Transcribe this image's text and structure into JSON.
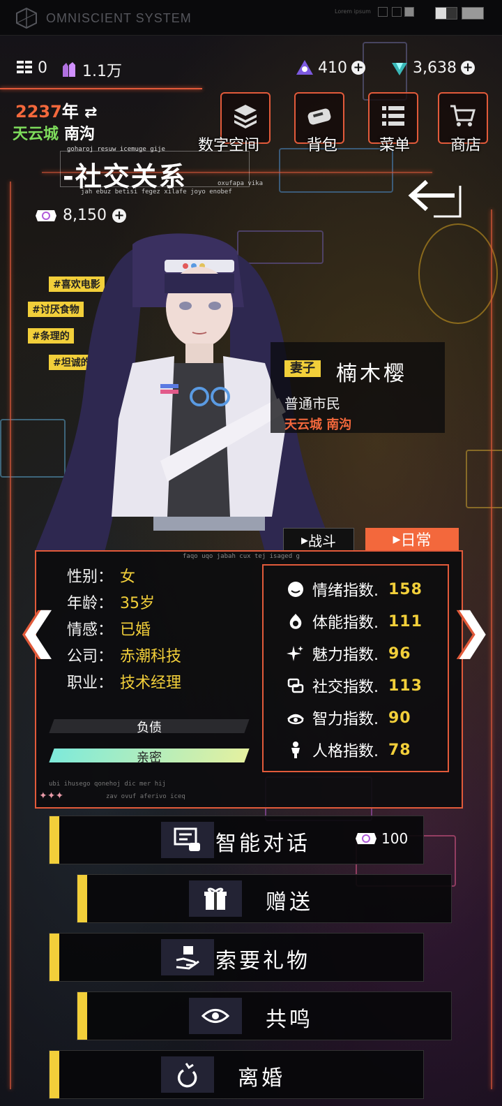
{
  "header": {
    "system_title": "OMNISCIENT SYSTEM",
    "lorem": "Lorem ipsum"
  },
  "resources": {
    "puzzle": "0",
    "crystal": "1.1万",
    "ticket": "410",
    "diamond": "3,638"
  },
  "date": {
    "year": "2237",
    "year_label": "年"
  },
  "location": {
    "city": "天云城",
    "district": "南沟"
  },
  "nav": [
    {
      "label": "数字空间",
      "icon": "data-stack-icon"
    },
    {
      "label": "背包",
      "icon": "bag-icon"
    },
    {
      "label": "菜单",
      "icon": "menu-list-icon"
    },
    {
      "label": "商店",
      "icon": "cart-icon"
    }
  ],
  "page": {
    "title": "-社交关系",
    "tiny1": "goharoj resuw icemuge gije",
    "tiny2": "oxufapa vika",
    "tiny3": "jah ebuz betisi fegez xilafe joyo enobef"
  },
  "coin": {
    "value": "8,150"
  },
  "tags": [
    "#喜欢电影",
    "#讨厌食物",
    "#条理的",
    "#坦诚的"
  ],
  "character": {
    "relation": "妻子",
    "name": "楠木樱",
    "role": "普通市民",
    "location": "天云城 南沟"
  },
  "tabs": {
    "battle": "战斗",
    "daily": "日常"
  },
  "panel_tiny": "faqo uqo jabah cux tej isaged g",
  "info": [
    {
      "label": "性别：",
      "value": "女"
    },
    {
      "label": "年龄：",
      "value": "35岁"
    },
    {
      "label": "情感：",
      "value": "已婚"
    },
    {
      "label": "公司：",
      "value": "赤潮科技"
    },
    {
      "label": "职业：",
      "value": "技术经理"
    }
  ],
  "stats": [
    {
      "label": "情绪指数.",
      "value": "158",
      "icon": "mood-icon"
    },
    {
      "label": "体能指数.",
      "value": "111",
      "icon": "stamina-icon"
    },
    {
      "label": "魅力指数.",
      "value": "96",
      "icon": "sparkle-icon"
    },
    {
      "label": "社交指数.",
      "value": "113",
      "icon": "social-icon"
    },
    {
      "label": "智力指数.",
      "value": "90",
      "icon": "intellect-icon"
    },
    {
      "label": "人格指数.",
      "value": "78",
      "icon": "person-icon"
    }
  ],
  "bars": {
    "debt": {
      "label": "负债",
      "fraction": 0.0
    },
    "intimacy": {
      "label": "亲密",
      "fraction": 1.0
    }
  },
  "panel_footer": {
    "tiny1": "ubi ihusego qonehoj dic mer hij",
    "tiny2": "zav ovuf aferivo iceq"
  },
  "actions": [
    {
      "label": "智能对话",
      "icon": "chat-icon",
      "cost": "100"
    },
    {
      "label": "赠送",
      "icon": "gift-icon"
    },
    {
      "label": "索要礼物",
      "icon": "hand-gift-icon"
    },
    {
      "label": "共鸣",
      "icon": "eye-icon"
    },
    {
      "label": "离婚",
      "icon": "broken-ring-icon"
    }
  ],
  "colors": {
    "accent": "#e25a3a",
    "orange": "#f3683c",
    "yellow": "#f2cf3a",
    "green": "#7edc5c"
  }
}
